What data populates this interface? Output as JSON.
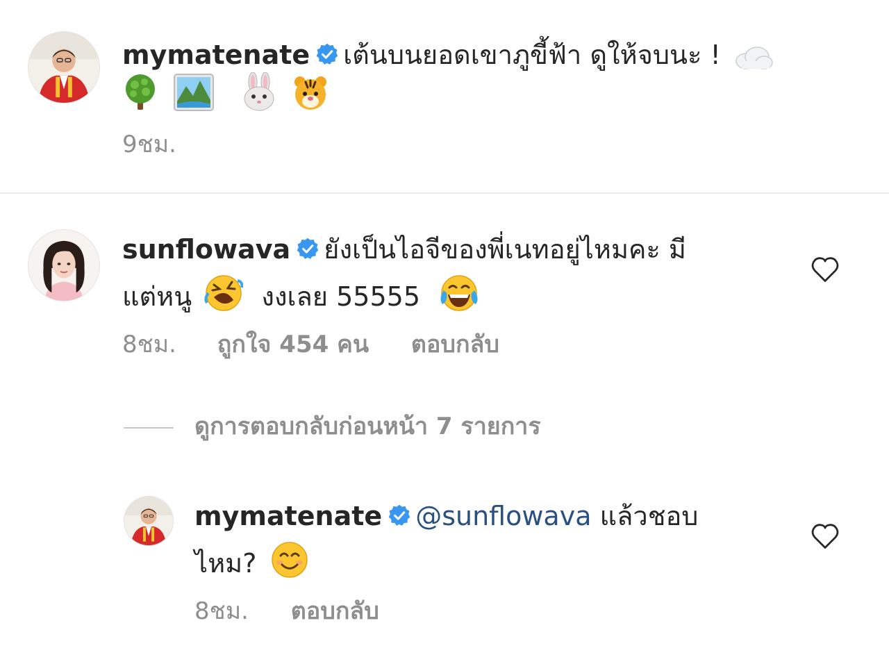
{
  "caption": {
    "username": "mymatenate",
    "text": "เต้นบนยอดเขาภูขี้ฟ้า ดูให้จบนะ !",
    "emojis_line1": [
      "cloud-emoji"
    ],
    "emojis_line2": [
      "tree-emoji",
      "mountain-photo-emoji",
      "rabbit-emoji",
      "tiger-emoji"
    ],
    "time": "9ชม."
  },
  "comment": {
    "username": "sunflowava",
    "text_line1": "ยังเป็นไอจีของพี่เนทอยู่ไหมคะ มี",
    "text_line2_a": "แต่หนู",
    "text_line2_b": "งงเลย 55555",
    "emojis": [
      "rofl-emoji",
      "tears-of-joy-emoji"
    ],
    "time": "8ชม.",
    "likes": "ถูกใจ 454 คน",
    "reply_label": "ตอบกลับ"
  },
  "view_replies": "ดูการตอบกลับก่อนหน้า 7 รายการ",
  "reply": {
    "username": "mymatenate",
    "mention": "@sunflowava",
    "text_line1": "แล้วชอบ",
    "text_line2": "ไหม?",
    "emojis": [
      "smiling-face-emoji"
    ],
    "time": "8ชม.",
    "reply_label": "ตอบกลับ"
  },
  "colors": {
    "text": "#262626",
    "meta": "#8e8e8e",
    "mention": "#2a4f82",
    "verified": "#3897f0",
    "divider": "#ececec"
  }
}
